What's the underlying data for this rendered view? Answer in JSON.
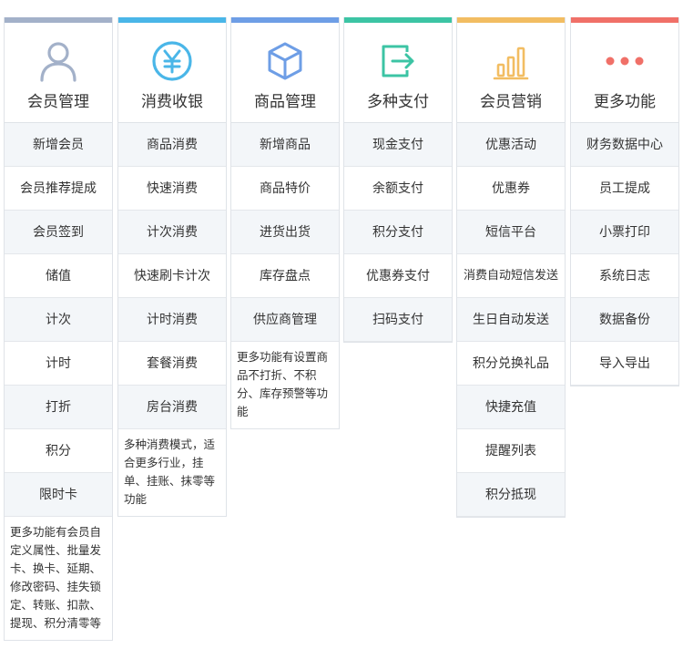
{
  "columns": [
    {
      "title": "会员管理",
      "icon": "user-icon",
      "accent": "#a3b1c9",
      "items": [
        "新增会员",
        "会员推荐提成",
        "会员签到",
        "储值",
        "计次",
        "计时",
        "打折",
        "积分",
        "限时卡"
      ],
      "note": "更多功能有会员自定义属性、批量发卡、换卡、延期、修改密码、挂失锁定、转账、扣款、提现、积分清零等"
    },
    {
      "title": "消费收银",
      "icon": "yen-coin-icon",
      "accent": "#4ab6e8",
      "items": [
        "商品消费",
        "快速消费",
        "计次消费",
        "快速刷卡计次",
        "计时消费",
        "套餐消费",
        "房台消费"
      ],
      "note": "多种消费模式，适合更多行业，挂单、挂账、抹零等功能"
    },
    {
      "title": "商品管理",
      "icon": "box-icon",
      "accent": "#6e9ee6",
      "items": [
        "新增商品",
        "商品特价",
        "进货出货",
        "库存盘点",
        "供应商管理"
      ],
      "note": "更多功能有设置商品不打折、不积分、库存预警等功能"
    },
    {
      "title": "多种支付",
      "icon": "exit-arrow-icon",
      "accent": "#3cc4a4",
      "items": [
        "现金支付",
        "余额支付",
        "积分支付",
        "优惠券支付",
        "扫码支付"
      ],
      "note": ""
    },
    {
      "title": "会员营销",
      "icon": "bar-chart-icon",
      "accent": "#f2bd62",
      "items": [
        "优惠活动",
        "优惠券",
        "短信平台",
        "消费自动短信发送",
        "生日自动发送",
        "积分兑换礼品",
        "快捷充值",
        "提醒列表",
        "积分抵现"
      ],
      "note": ""
    },
    {
      "title": "更多功能",
      "icon": "more-dots-icon",
      "accent": "#f07068",
      "items": [
        "财务数据中心",
        "员工提成",
        "小票打印",
        "系统日志",
        "数据备份",
        "导入导出"
      ],
      "note": ""
    }
  ]
}
